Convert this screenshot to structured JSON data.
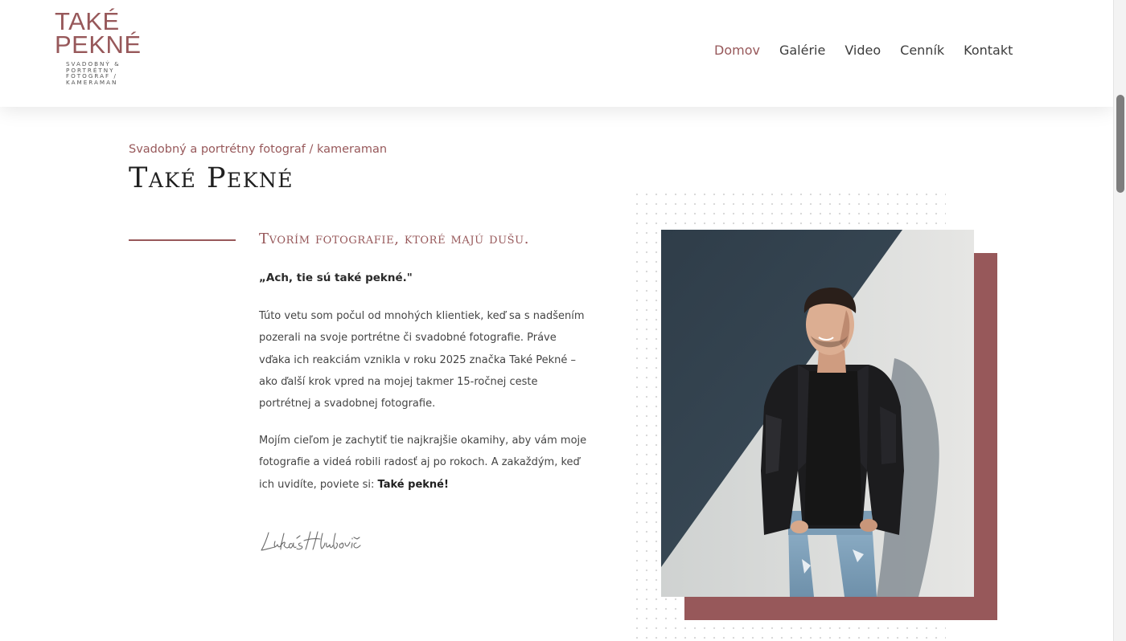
{
  "header": {
    "logo": {
      "line1": "TAKÉ",
      "line2": "PEKNÉ",
      "tagline": "SVADOBNÝ & PORTRÉTNY FOTOGRAF / KAMERAMAN"
    },
    "nav": [
      {
        "label": "Domov",
        "active": true
      },
      {
        "label": "Galérie",
        "active": false
      },
      {
        "label": "Video",
        "active": false
      },
      {
        "label": "Cenník",
        "active": false
      },
      {
        "label": "Kontakt",
        "active": false
      }
    ]
  },
  "main": {
    "eyebrow": "Svadobný a portrétny fotograf / kameraman",
    "title": "Také Pekné",
    "section_heading": "Tvorím fotografie, ktoré majú dušu.",
    "quote": "„Ach, tie sú také pekné.\"",
    "paragraph1": "Túto vetu som počul od mnohých klientiek, keď sa s nadšením pozerali na svoje portrétne či svadobné fotografie. Práve vďaka ich reakciám vznikla v roku 2025 značka Také Pekné – ako ďalší krok vpred na mojej takmer 15-ročnej ceste portrétnej a svadobnej fotografie.",
    "paragraph2_text": "Mojím cieľom je zachytiť tie najkrajšie okamihy, aby vám moje fotografie a videá robili radosť aj po rokoch. A zakaždým, keď ich uvidíte, poviete si: ",
    "paragraph2_emphasis": "Také pekné!",
    "signature": "Lukáš Hlubovič",
    "photo_icon": "portrait-photo"
  },
  "colors": {
    "accent": "#97585a",
    "text": "#444444",
    "heading": "#1f1f1f"
  }
}
